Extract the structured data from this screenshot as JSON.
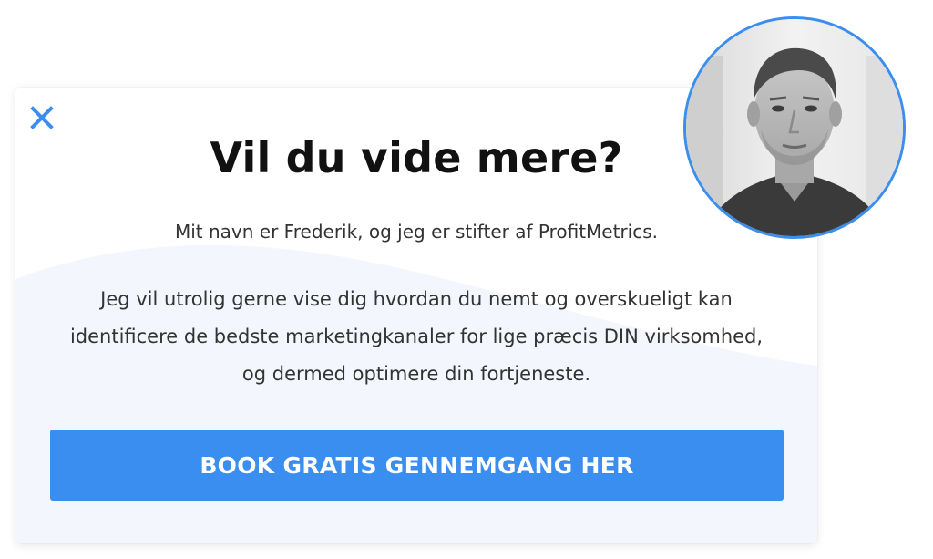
{
  "modal": {
    "close_icon": "close-icon",
    "title": "Vil du vide mere?",
    "intro": "Mit navn er Frederik, og jeg er stifter af ProfitMetrics.",
    "body_lines": [
      "Jeg vil utrolig gerne vise dig hvordan du nemt og overskueligt kan",
      "identificere de bedste marketingkanaler for lige præcis DIN virksomhed,",
      "og dermed optimere din fortjeneste."
    ],
    "cta_label": "BOOK GRATIS GENNEMGANG HER"
  },
  "avatar": {
    "description_icon": "portrait-photo"
  },
  "colors": {
    "accent": "#3a8ef0",
    "title": "#111111",
    "text": "#333333",
    "wave": "#f3f6fc"
  }
}
